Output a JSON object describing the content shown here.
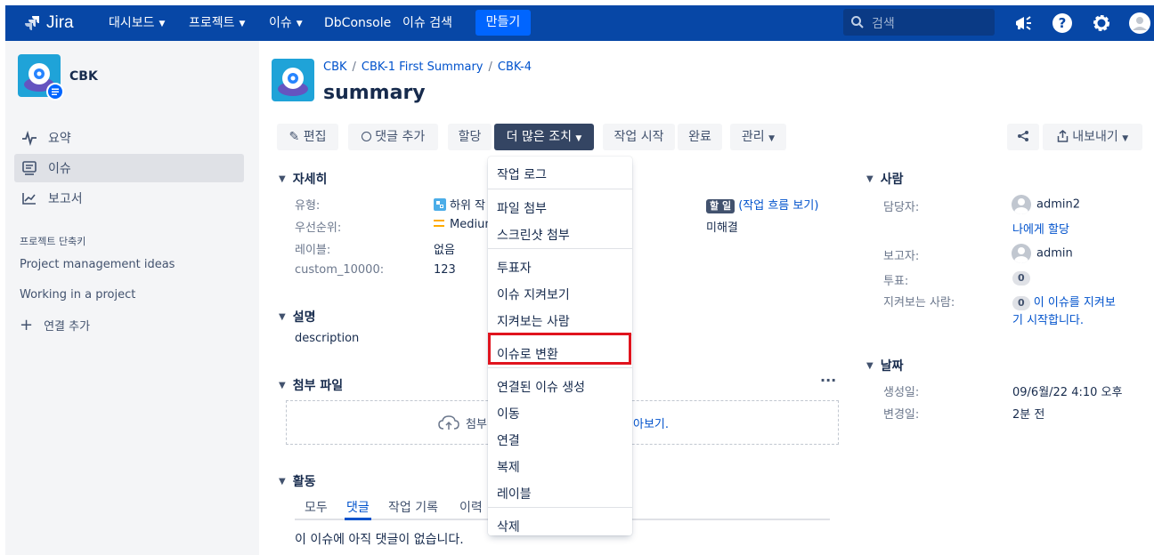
{
  "topnav": {
    "logo_text": "Jira",
    "items": [
      {
        "label": "대시보드",
        "has_dropdown": true
      },
      {
        "label": "프로젝트",
        "has_dropdown": true
      },
      {
        "label": "이슈",
        "has_dropdown": true
      },
      {
        "label": "DbConsole",
        "has_dropdown": false
      },
      {
        "label": "이슈 검색",
        "has_dropdown": false
      }
    ],
    "create_label": "만들기",
    "search_placeholder": "검색",
    "icons": [
      "megaphone-icon",
      "help-icon",
      "settings-icon",
      "user-avatar"
    ]
  },
  "sidebar": {
    "project_name": "CBK",
    "items": [
      {
        "label": "요약",
        "icon": "activity-icon",
        "active": false
      },
      {
        "label": "이슈",
        "icon": "issues-icon",
        "active": true
      },
      {
        "label": "보고서",
        "icon": "reports-icon",
        "active": false
      }
    ],
    "shortcuts_heading": "프로젝트 단축키",
    "shortcuts": [
      "Project management ideas",
      "Working in a project"
    ],
    "add_link_label": "연결 추가"
  },
  "issue": {
    "breadcrumb": [
      "CBK",
      "CBK-1 First Summary",
      "CBK-4"
    ],
    "title": "summary"
  },
  "toolbar": {
    "edit": "편집",
    "comment": "댓글 추가",
    "assign": "할당",
    "more": "더 많은 조치",
    "start": "작업 시작",
    "done": "완료",
    "admin": "관리",
    "export": "내보내기"
  },
  "details": {
    "heading": "자세히",
    "fields": [
      {
        "label": "유형:",
        "value": "하위 작"
      },
      {
        "label": "우선순위:",
        "value": "Medium"
      },
      {
        "label": "레이블:",
        "value": "없음"
      },
      {
        "label": "custom_10000:",
        "value": "123"
      }
    ],
    "status_badge": "할 일",
    "workflow_link": "(작업 흐름 보기)",
    "resolution": "미해결"
  },
  "description": {
    "heading": "설명",
    "text": "description"
  },
  "attachments": {
    "heading": "첨부 파일",
    "drop_prefix": "첨부",
    "drop_suffix": "아보기."
  },
  "activity": {
    "heading": "활동",
    "tabs": [
      "모두",
      "댓글",
      "작업 기록",
      "이력"
    ],
    "active_tab": "댓글",
    "empty_text": "이 이슈에 아직 댓글이 없습니다."
  },
  "dropdown": {
    "groups": [
      [
        "작업 로그"
      ],
      [
        "파일 첨부",
        "스크린샷 첨부"
      ],
      [
        "투표자",
        "이슈 지켜보기",
        "지켜보는 사람"
      ],
      [
        "이슈로 변환"
      ],
      [
        "연결된 이슈 생성",
        "이동",
        "연결",
        "복제",
        "레이블"
      ],
      [
        "삭제"
      ]
    ],
    "highlighted": "이슈로 변환"
  },
  "people": {
    "heading": "사람",
    "assignee_label": "담당자:",
    "assignee": "admin2",
    "assign_to_me": "나에게 할당",
    "reporter_label": "보고자:",
    "reporter": "admin",
    "votes_label": "투표:",
    "votes": "0",
    "watchers_label": "지켜보는 사람:",
    "watchers": "0",
    "watch_link_line1": "이 이슈를 지켜보",
    "watch_link_line2": "기 시작합니다."
  },
  "dates": {
    "heading": "날짜",
    "created_label": "생성일:",
    "created": "09/6월/22 4:10 오후",
    "updated_label": "변경일:",
    "updated": "2분 전"
  }
}
